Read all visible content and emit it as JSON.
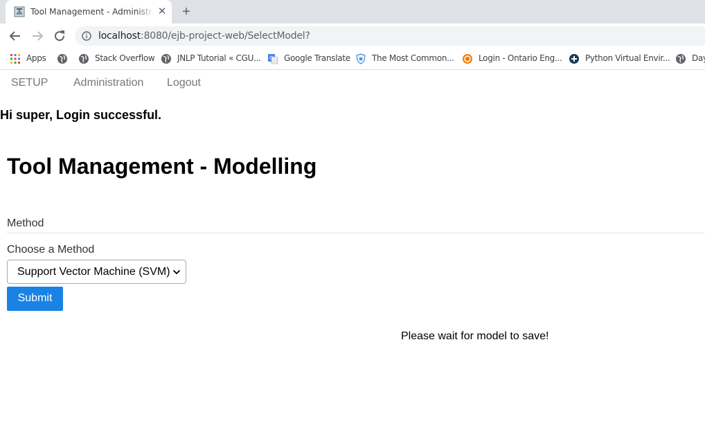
{
  "browser": {
    "tab_title": "Tool Management - Administration",
    "tab_close": "✕",
    "new_tab": "+",
    "url_host": "localhost",
    "url_rest": ":8080/ejb-project-web/SelectModel?"
  },
  "bookmarks": [
    {
      "label": "Apps",
      "icon": "apps-grid-icon"
    },
    {
      "label": "",
      "icon": "globe-icon"
    },
    {
      "label": "Stack Overflow",
      "icon": "globe-icon"
    },
    {
      "label": "JNLP Tutorial « CGU...",
      "icon": "globe-icon"
    },
    {
      "label": "Google Translate",
      "icon": "google-translate-icon"
    },
    {
      "label": "The Most Common...",
      "icon": "shield-icon"
    },
    {
      "label": "Login - Ontario Eng...",
      "icon": "orange-circle-icon"
    },
    {
      "label": "Python Virtual Envir...",
      "icon": "python-icon"
    },
    {
      "label": "Day",
      "icon": "globe-icon"
    }
  ],
  "navbar": {
    "setup": "SETUP",
    "administration": "Administration",
    "logout": "Logout"
  },
  "greeting": "Hi super, Login successful.",
  "page_title": "Tool Management - Modelling",
  "form": {
    "legend": "Method",
    "select_label": "Choose a Method",
    "selected_method": "Support Vector Machine (SVM)",
    "submit_label": "Submit"
  },
  "status_message": "Please wait for model to save!",
  "colors": {
    "submit_button": "#1a82e2",
    "nav_link": "#777777"
  }
}
